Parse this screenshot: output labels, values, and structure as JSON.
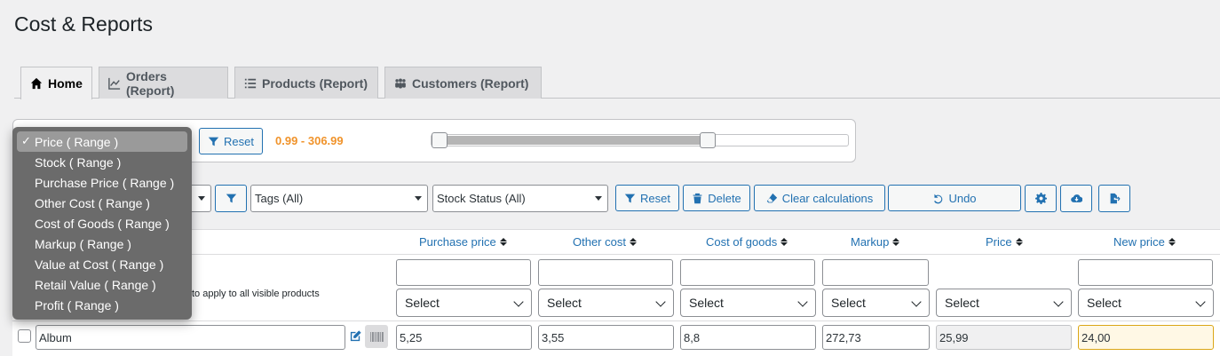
{
  "page": {
    "title": "Cost & Reports"
  },
  "tabs": [
    {
      "label": "Home",
      "icon": "home-icon",
      "active": true
    },
    {
      "label": "Orders (Report)",
      "icon": "line-chart-icon",
      "active": false
    },
    {
      "label": "Products (Report)",
      "icon": "list-icon",
      "active": false
    },
    {
      "label": "Customers (Report)",
      "icon": "users-icon",
      "active": false
    }
  ],
  "range_filter": {
    "reset_label": "Reset",
    "value_text": "0.99 - 306.99",
    "slider_fraction": [
      0.0,
      0.67
    ],
    "menu_items": [
      "Price ( Range )",
      "Stock ( Range )",
      "Purchase Price ( Range )",
      "Other Cost ( Range )",
      "Cost of Goods ( Range )",
      "Markup ( Range )",
      "Value at Cost ( Range )",
      "Retail Value ( Range )",
      "Profit ( Range )"
    ],
    "selected_index": 0,
    "check_mark": "✓"
  },
  "toolbar": {
    "tags_select": "Tags (All)",
    "stock_status_select": "Stock Status (All)",
    "reset_label": "Reset",
    "delete_label": "Delete",
    "clear_label": "Clear calculations",
    "undo_label": "Undo"
  },
  "table": {
    "columns": [
      "Purchase price",
      "Other cost",
      "Cost of goods",
      "Markup",
      "Price",
      "New price"
    ],
    "bulk_select_label": "Select",
    "apply_note": "to apply to all visible products",
    "rows": [
      {
        "name": "Album",
        "purchase_price": "5,25",
        "other_cost": "3,55",
        "cost_of_goods": "8,8",
        "markup": "272,73",
        "price": "25,99",
        "new_price": "24,00"
      }
    ]
  },
  "colors": {
    "accent": "#2271b1",
    "range_value": "#f0932b",
    "menu_bg": "#6b6b6b"
  }
}
